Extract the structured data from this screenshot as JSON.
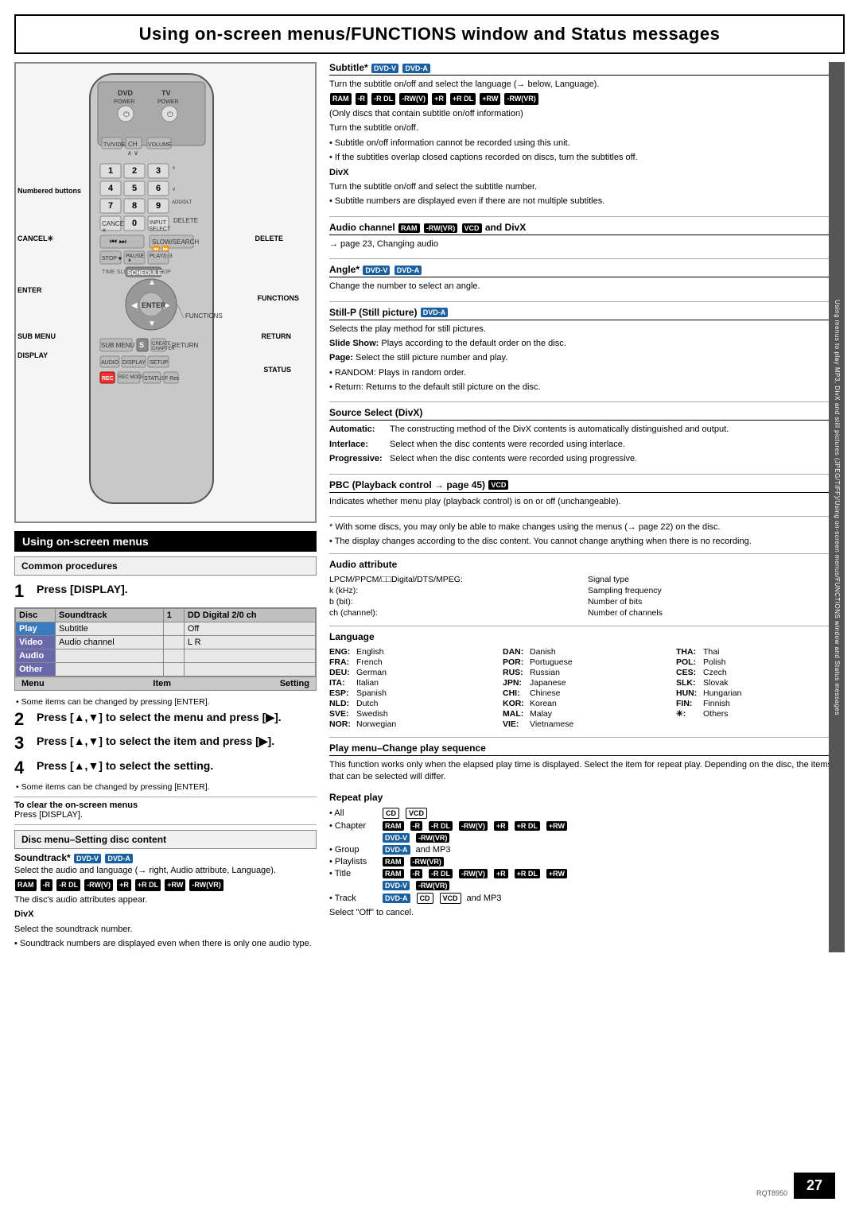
{
  "header": {
    "title": "Using on-screen menus/FUNCTIONS window and Status messages"
  },
  "left": {
    "section_heading": "Using on-screen menus",
    "common_procedures_label": "Common procedures",
    "steps": [
      {
        "num": "1",
        "text": "Press [DISPLAY]."
      },
      {
        "num": "2",
        "text": "Press [▲,▼] to select the menu and press [▶]."
      },
      {
        "num": "3",
        "text": "Press [▲,▼] to select the item and press [▶]."
      },
      {
        "num": "4",
        "text": "Press [▲,▼] to select the setting."
      }
    ],
    "osd_table": {
      "rows": [
        {
          "col1": "Disc",
          "col2": "Soundtrack",
          "col3": "1",
          "col4": "DD Digital 2/0 ch"
        },
        {
          "col1": "Play",
          "col2": "Subtitle",
          "col3": "",
          "col4": "Off"
        },
        {
          "col1": "Video",
          "col2": "Audio channel",
          "col3": "",
          "col4": "L R"
        },
        {
          "col1": "Audio",
          "col2": "",
          "col3": "",
          "col4": ""
        },
        {
          "col1": "Other",
          "col2": "",
          "col3": "",
          "col4": ""
        }
      ],
      "footer": [
        "Menu",
        "Item",
        "Setting"
      ]
    },
    "note_items_change": "• Some items can be changed by pressing [ENTER].",
    "clear_heading": "To clear the on-screen menus",
    "clear_text": "Press [DISPLAY].",
    "disc_menu_label": "Disc menu–Setting disc content",
    "soundtrack_title": "Soundtrack*",
    "soundtrack_badges": [
      "DVD-V",
      "DVD-A"
    ],
    "soundtrack_text": "Select the audio and language (→ right, Audio attribute, Language).",
    "ram_badges_1": [
      "RAM",
      "-R",
      "-R DL",
      "-RW(V)",
      "+R",
      "+R DL",
      "+RW",
      "-RW(VR)"
    ],
    "disc_audio_text": "The disc's audio attributes appear.",
    "divx_title": "DivX",
    "divx_soundtrack": "Select the soundtrack number.",
    "soundtrack_note": "• Soundtrack numbers are displayed even when there is only one audio type."
  },
  "right": {
    "subtitle_title": "Subtitle*",
    "subtitle_badges_title": [
      "DVD-V",
      "DVD-A"
    ],
    "subtitle_text1": "Turn the subtitle on/off and select the language (→ below, Language).",
    "ram_badges_subtitle": [
      "RAM",
      "-R",
      "-R DL",
      "-RW(V)",
      "+R",
      "+R DL",
      "+RW",
      "-RW(VR)"
    ],
    "subtitle_only_discs": "(Only discs that contain subtitle on/off information)",
    "subtitle_text2": "Turn the subtitle on/off.",
    "subtitle_note1": "• Subtitle on/off information cannot be recorded using this unit.",
    "subtitle_note2": "• If the subtitles overlap closed captions recorded on discs, turn the subtitles off.",
    "divx_subtitle_title": "DivX",
    "divx_subtitle_text": "Turn the subtitle on/off and select the subtitle number.",
    "divx_subtitle_note": "• Subtitle numbers are displayed even if there are not multiple subtitles.",
    "audio_channel_title": "Audio channel",
    "audio_channel_badges": [
      "RAM",
      "-RW(VR)",
      "VCD"
    ],
    "audio_channel_and": "and",
    "audio_channel_divx": "DivX",
    "audio_channel_ref": "→ page 23, Changing audio",
    "angle_title": "Angle*",
    "angle_badges": [
      "DVD-V",
      "DVD-A"
    ],
    "angle_text": "Change the number to select an angle.",
    "still_title": "Still-P (Still picture)",
    "still_badge": "DVD-A",
    "still_text": "Selects the play method for still pictures.",
    "still_slide": "Slide Show: Plays according to the default order on the disc.",
    "still_page": "Page: Select the still picture number and play.",
    "still_random": "• RANDOM: Plays in random order.",
    "still_return": "• Return: Returns to the default still picture on the disc.",
    "source_select_title": "Source Select (DivX)",
    "source_auto_label": "Automatic:",
    "source_auto_text": "The constructing method of the DivX contents is automatically distinguished and output.",
    "source_interlace_label": "Interlace:",
    "source_interlace_text": "Select when the disc contents were recorded using interlace.",
    "source_progressive_label": "Progressive:",
    "source_progressive_text": "Select when the disc contents were recorded using progressive.",
    "pbc_title": "PBC (Playback control → page 45)",
    "pbc_badge": "VCD",
    "pbc_text": "Indicates whether menu play (playback control) is on or off (unchangeable).",
    "note_discs": "* With some discs, you may only be able to make changes using the menus (→ page 22) on the disc.",
    "note_display": "• The display changes according to the disc content. You cannot change anything when there is no recording.",
    "audio_attr_title": "Audio attribute",
    "audio_attr_rows": [
      {
        "key": "LPCM/PPCM/□□Digital/DTS/MPEG:",
        "value": "Signal type"
      },
      {
        "key": "k (kHz):",
        "value": "Sampling frequency"
      },
      {
        "key": "b (bit):",
        "value": "Number of bits"
      },
      {
        "key": "ch (channel):",
        "value": "Number of channels"
      }
    ],
    "language_title": "Language",
    "language_items": [
      {
        "code": "ENG:",
        "name": "English"
      },
      {
        "code": "DAN:",
        "name": "Danish"
      },
      {
        "code": "THA:",
        "name": "Thai"
      },
      {
        "code": "FRA:",
        "name": "French"
      },
      {
        "code": "POR:",
        "name": "Portuguese"
      },
      {
        "code": "POL:",
        "name": "Polish"
      },
      {
        "code": "DEU:",
        "name": "German"
      },
      {
        "code": "RUS:",
        "name": "Russian"
      },
      {
        "code": "CES:",
        "name": "Czech"
      },
      {
        "code": "ITA:",
        "name": "Italian"
      },
      {
        "code": "JPN:",
        "name": "Japanese"
      },
      {
        "code": "SLK:",
        "name": "Slovak"
      },
      {
        "code": "ESP:",
        "name": "Spanish"
      },
      {
        "code": "CHI:",
        "name": "Chinese"
      },
      {
        "code": "HUN:",
        "name": "Hungarian"
      },
      {
        "code": "NLD:",
        "name": "Dutch"
      },
      {
        "code": "KOR:",
        "name": "Korean"
      },
      {
        "code": "FIN:",
        "name": "Finnish"
      },
      {
        "code": "SVE:",
        "name": "Swedish"
      },
      {
        "code": "MAL:",
        "name": "Malay"
      },
      {
        "code": "✳:",
        "name": "Others"
      },
      {
        "code": "NOR:",
        "name": "Norwegian"
      },
      {
        "code": "VIE:",
        "name": "Vietnamese"
      },
      {
        "code": "",
        "name": ""
      }
    ],
    "play_menu_title": "Play menu–Change play sequence",
    "play_menu_text": "This function works only when the elapsed play time is displayed. Select the item for repeat play. Depending on the disc, the items that can be selected will differ.",
    "repeat_play_title": "Repeat play",
    "repeat_rows": [
      {
        "label": "• All",
        "badges": [
          "CD",
          "VCD"
        ],
        "extra": ""
      },
      {
        "label": "• Chapter",
        "badges": [
          "RAM",
          "-R",
          "-R DL",
          "-RW(V)",
          "+R",
          "+R DL",
          "+RW"
        ],
        "extra": ""
      },
      {
        "label": "",
        "badges": [
          "DVD-V",
          "-RW(VR)"
        ],
        "extra": ""
      },
      {
        "label": "• Group",
        "badges": [
          "DVD-A"
        ],
        "extra": "and MP3"
      },
      {
        "label": "• Playlists",
        "badges": [
          "RAM",
          "-RW(VR)"
        ],
        "extra": ""
      },
      {
        "label": "• Title",
        "badges": [
          "RAM",
          "-R",
          "-R DL",
          "-RW(V)",
          "+R",
          "+R DL",
          "+RW"
        ],
        "extra": ""
      },
      {
        "label": "",
        "badges": [
          "DVD-V",
          "-RW(VR)"
        ],
        "extra": ""
      },
      {
        "label": "• Track",
        "badges": [
          "DVD-A",
          "CD",
          "VCD"
        ],
        "extra": "and MP3"
      }
    ],
    "select_off": "Select \"Off\" to cancel.",
    "page_number": "27",
    "rqt": "RQT8950"
  },
  "remote_labels": {
    "numbered_buttons": "Numbered buttons",
    "cancel": "CANCEL✳",
    "enter": "ENTER",
    "sub_menu": "SUB MENU",
    "display": "DISPLAY",
    "delete": "DELETE",
    "functions": "FUNCTIONS",
    "return": "RETURN",
    "status": "STATUS"
  },
  "side_text": "Using menus to play MP3, DivX and still pictures (JPEG/TIFF)/Using on-screen menus/FUNCTIONS window and Status messages"
}
